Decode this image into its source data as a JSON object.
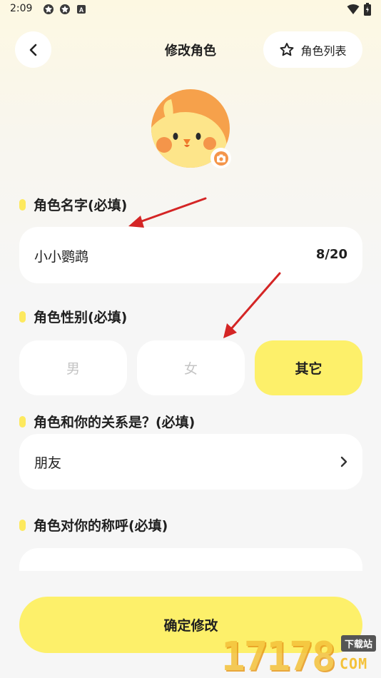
{
  "status_bar": {
    "time": "2:09",
    "icons_left": [
      "settings-gear-icon",
      "settings-gear-icon",
      "a-letter-icon"
    ],
    "icons_right": [
      "wifi-icon",
      "battery-icon"
    ]
  },
  "header": {
    "title": "修改角色",
    "back_icon": "chevron-left-icon",
    "role_list_label": "角色列表",
    "role_list_icon": "star-outline-icon"
  },
  "avatar": {
    "icon": "chick-avatar",
    "edit_icon": "camera-icon"
  },
  "sections": {
    "name": {
      "label": "角色名字(必填)",
      "value": "小小鹦鹉",
      "count": "8/20"
    },
    "gender": {
      "label": "角色性别(必填)",
      "options": [
        "男",
        "女",
        "其它"
      ],
      "selected": "其它"
    },
    "relation": {
      "label": "角色和你的关系是？(必填)",
      "value": "朋友"
    },
    "callname": {
      "label": "角色对你的称呼(必填)"
    }
  },
  "confirm_label": "确定修改",
  "watermark": {
    "digits": "17178",
    "tag": "下载站",
    "com": "COM"
  },
  "colors": {
    "accent": "#fdf06a",
    "annotation_arrow": "#d42525"
  }
}
